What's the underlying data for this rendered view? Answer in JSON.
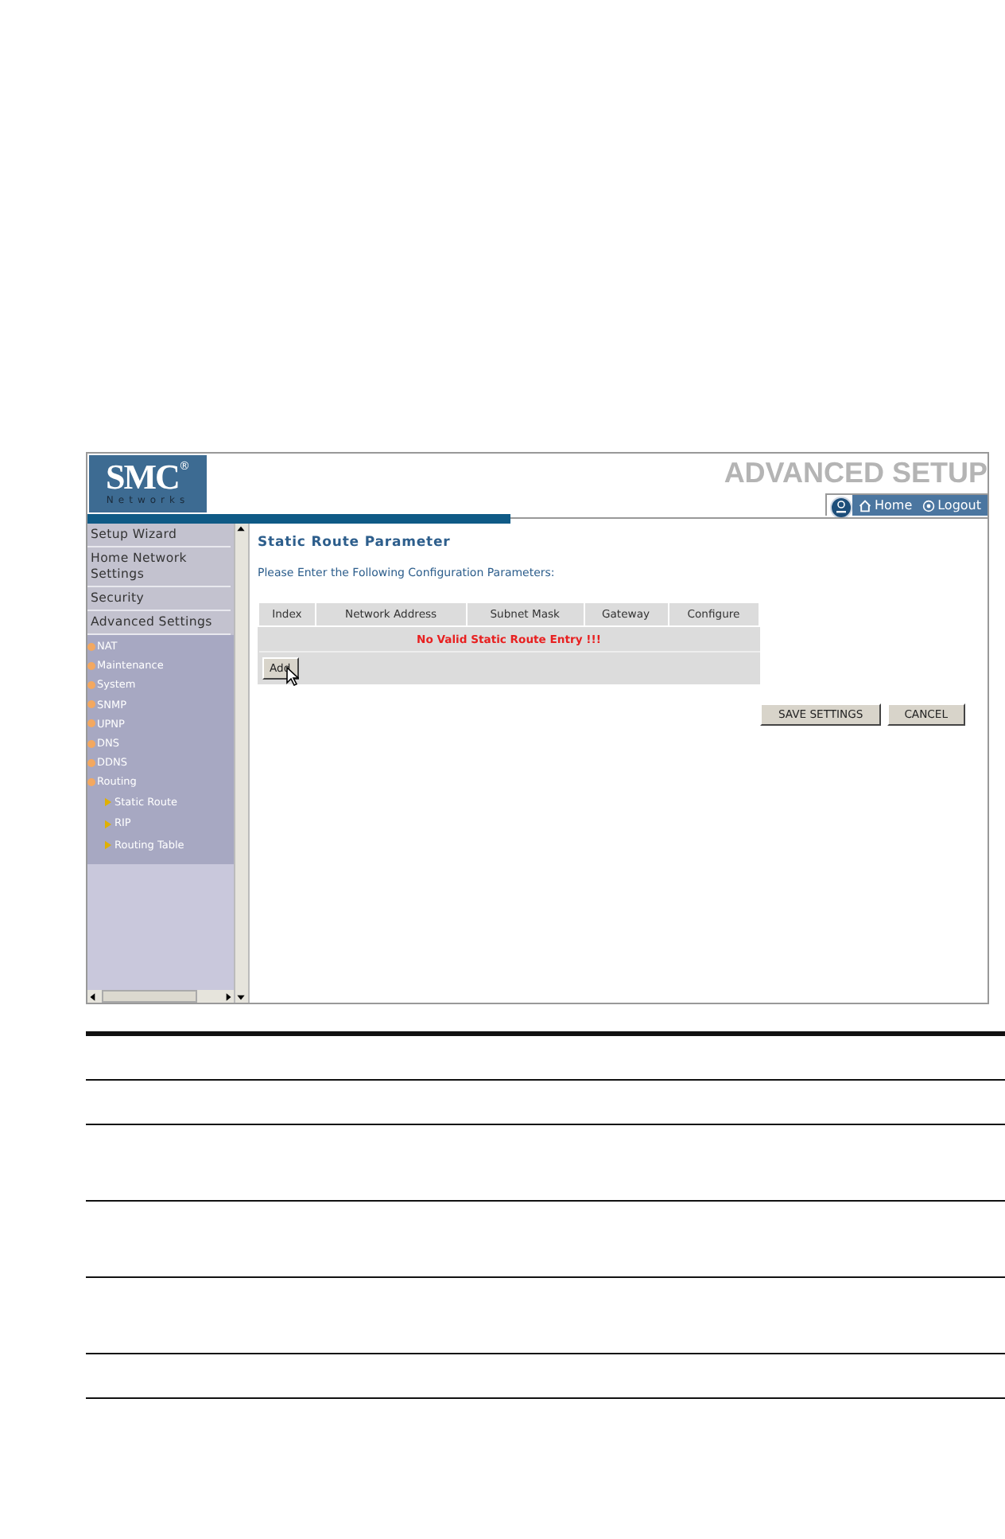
{
  "header": {
    "logo": "SMC",
    "logo_mark": "®",
    "logo_sub": "Networks",
    "title": "ADVANCED SETUP",
    "tabs": [
      {
        "label": "Home"
      },
      {
        "label": "Logout"
      }
    ]
  },
  "sidebar": {
    "items": [
      {
        "label": "Setup Wizard"
      },
      {
        "label": "Home Network Settings"
      },
      {
        "label": "Security"
      },
      {
        "label": "Advanced Settings",
        "children": [
          {
            "label": "NAT"
          },
          {
            "label": "Maintenance"
          },
          {
            "label": "System"
          },
          {
            "label": "SNMP"
          },
          {
            "label": "UPNP"
          },
          {
            "label": "DNS"
          },
          {
            "label": "DDNS"
          },
          {
            "label": "Routing",
            "children": [
              {
                "label": "Static Route"
              },
              {
                "label": "RIP"
              },
              {
                "label": "Routing Table"
              }
            ]
          }
        ]
      }
    ]
  },
  "content": {
    "heading": "Static Route Parameter",
    "instruction": "Please Enter the Following Configuration Parameters:",
    "table": {
      "columns": [
        "Index",
        "Network Address",
        "Subnet Mask",
        "Gateway",
        "Configure"
      ],
      "empty_message": "No Valid Static Route Entry !!!",
      "add_button": "Add"
    },
    "buttons": [
      "SAVE SETTINGS",
      "CANCEL"
    ]
  }
}
